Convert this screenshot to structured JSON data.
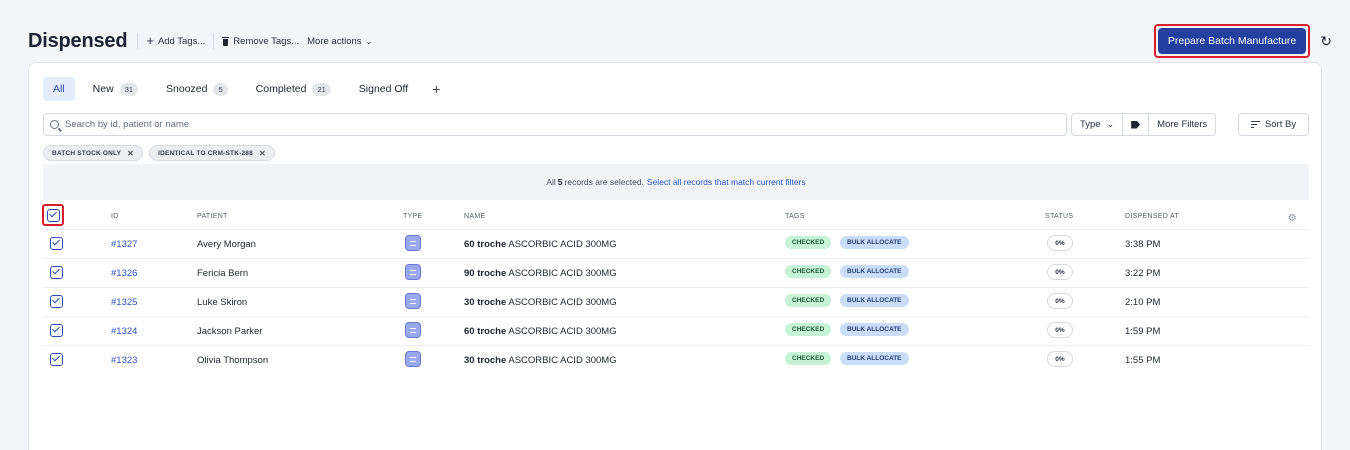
{
  "header": {
    "title": "Dispensed",
    "add_tags": "Add Tags...",
    "remove_tags": "Remove Tags...",
    "more_actions": "More actions",
    "primary_action": "Prepare Batch Manufacture"
  },
  "tabs": [
    {
      "label": "All",
      "count": ""
    },
    {
      "label": "New",
      "count": "31"
    },
    {
      "label": "Snoozed",
      "count": "5"
    },
    {
      "label": "Completed",
      "count": "21"
    },
    {
      "label": "Signed Off",
      "count": ""
    }
  ],
  "search": {
    "placeholder": "Search by id, patient or name"
  },
  "filters": {
    "type": "Type",
    "more_filters": "More Filters",
    "sort_by": "Sort By"
  },
  "chips": [
    "BATCH STOCK ONLY",
    "IDENTICAL TO CRM-STK-288"
  ],
  "selection_banner": {
    "prefix": "All",
    "count": "5",
    "suffix": "records are selected.",
    "link": "Select all records that match current filters"
  },
  "columns": {
    "id": "ID",
    "patient": "PATIENT",
    "type": "TYPE",
    "name": "NAME",
    "tags": "TAGS",
    "status": "STATUS",
    "dispensed_at": "DISPENSED AT"
  },
  "rows": [
    {
      "id": "#1327",
      "patient": "Avery Morgan",
      "qty": "60 troche",
      "name": "ASCORBIC ACID 300MG",
      "tags": [
        "CHECKED",
        "BULK ALLOCATE"
      ],
      "status": "0%",
      "time": "3:38 PM"
    },
    {
      "id": "#1326",
      "patient": "Fericia Bern",
      "qty": "90 troche",
      "name": "ASCORBIC ACID 300MG",
      "tags": [
        "CHECKED",
        "BULK ALLOCATE"
      ],
      "status": "0%",
      "time": "3:22 PM"
    },
    {
      "id": "#1325",
      "patient": "Luke Skiron",
      "qty": "30 troche",
      "name": "ASCORBIC ACID 300MG",
      "tags": [
        "CHECKED",
        "BULK ALLOCATE"
      ],
      "status": "0%",
      "time": "2:10 PM"
    },
    {
      "id": "#1324",
      "patient": "Jackson Parker",
      "qty": "60 troche",
      "name": "ASCORBIC ACID 300MG",
      "tags": [
        "CHECKED",
        "BULK ALLOCATE"
      ],
      "status": "0%",
      "time": "1:59 PM"
    },
    {
      "id": "#1323",
      "patient": "Olivia Thompson",
      "qty": "30 troche",
      "name": "ASCORBIC ACID 300MG",
      "tags": [
        "CHECKED",
        "BULK ALLOCATE"
      ],
      "status": "0%",
      "time": "1:55 PM"
    }
  ],
  "colors": {
    "primary": "#24409e",
    "link": "#2b55c8",
    "highlight": "#d6202e",
    "tag_checked": "#c6f2d6",
    "tag_bulk": "#c9dcf8"
  }
}
